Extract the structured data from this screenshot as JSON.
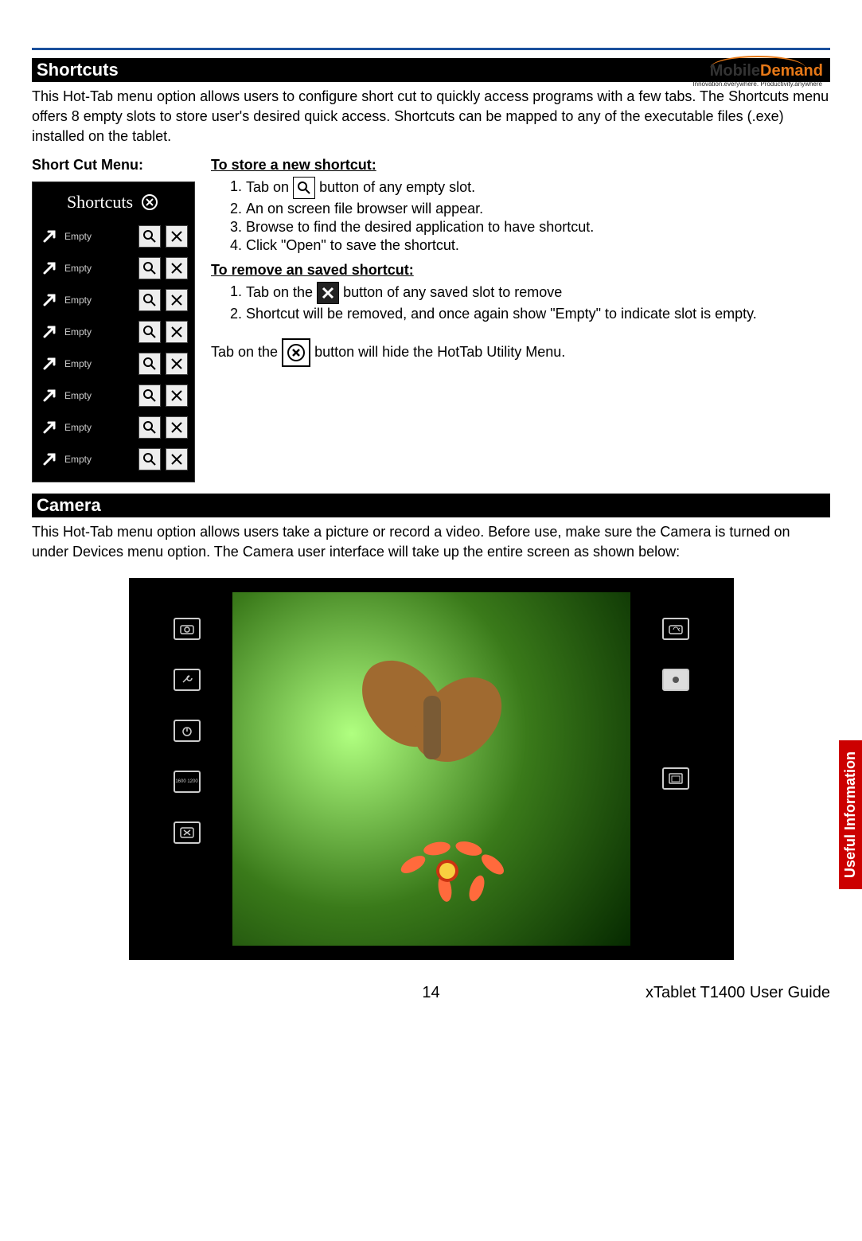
{
  "logo": {
    "brand_left": "Mobile",
    "brand_right": "Demand",
    "tagline": "Innovation.everywhere. Productivity.anywhere"
  },
  "side_tab": "Useful Information",
  "sections": {
    "shortcuts": {
      "heading": "Shortcuts",
      "intro": "This Hot-Tab menu option allows users to configure short cut to quickly access programs with a few tabs. The Shortcuts menu offers 8 empty slots to store user's desired quick access. Shortcuts can be mapped to any of the executable files (.exe) installed on the tablet.",
      "left_title": "Short Cut Menu:",
      "panel_title": "Shortcuts",
      "slot_label": "Empty",
      "store_heading": "To store a new shortcut:",
      "store_steps": {
        "s1a": "Tab on ",
        "s1b": " button of any empty slot.",
        "s2": "An on screen file browser will appear.",
        "s3": "Browse to find the desired application to have shortcut.",
        "s4": "Click \"Open\" to save the shortcut."
      },
      "remove_heading": "To remove an saved shortcut:",
      "remove_steps": {
        "r1a": "Tab on the ",
        "r1b": " button of any saved slot to remove",
        "r2": "Shortcut will be removed, and once again show \"Empty\" to indicate slot is empty."
      },
      "hide_a": "Tab on the ",
      "hide_b": " button will hide the HotTab Utility Menu."
    },
    "camera": {
      "heading": "Camera",
      "intro": "This Hot-Tab menu option allows users take a picture or record a video. Before use, make sure the Camera is turned on under Devices menu option. The Camera user interface will take up the entire screen as shown below:",
      "left_labels": {
        "res": "1600 1200"
      }
    }
  },
  "footer": {
    "page_num": "14",
    "guide": "xTablet T1400 User Guide"
  }
}
